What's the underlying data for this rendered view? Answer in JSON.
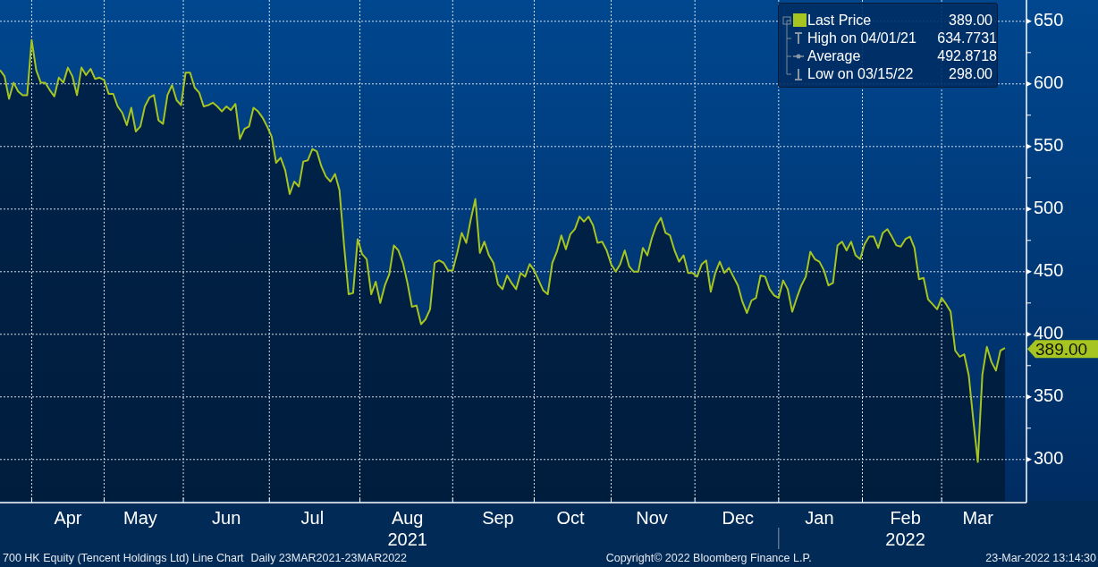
{
  "chart": {
    "chart_data": {
      "type": "area",
      "categories": [
        null,
        null,
        null,
        null,
        null,
        null,
        null,
        null,
        null,
        null,
        null,
        null,
        null,
        null,
        null,
        "Apr",
        null,
        null,
        null,
        null,
        null,
        null,
        null,
        null,
        null,
        null,
        null,
        null,
        null,
        null,
        null,
        "May",
        null,
        null,
        null,
        null,
        null,
        null,
        null,
        null,
        null,
        null,
        null,
        null,
        null,
        null,
        null,
        null,
        null,
        null,
        "Jun",
        null,
        null,
        null,
        null,
        null,
        null,
        null,
        null,
        null,
        null,
        null,
        null,
        null,
        null,
        null,
        null,
        null,
        null,
        "Jul",
        null,
        null,
        null,
        null,
        null,
        null,
        null,
        null,
        null,
        null,
        null,
        null,
        null,
        null,
        null,
        null,
        null,
        null,
        null,
        null,
        "Aug",
        null,
        null,
        null,
        null,
        null,
        null,
        null,
        null,
        null,
        null,
        null,
        null,
        null,
        null,
        null,
        null,
        null,
        null,
        null,
        "Sep",
        null,
        null,
        null,
        null,
        null,
        null,
        null,
        null,
        null,
        null,
        null,
        null,
        null,
        null,
        null,
        "Oct",
        null,
        null,
        null,
        null,
        null,
        null,
        null,
        null,
        null,
        null,
        null,
        null,
        null,
        null,
        null,
        null,
        null,
        "Nov",
        null,
        null,
        null,
        null,
        null,
        null,
        null,
        null,
        null,
        null,
        null,
        null,
        null,
        null,
        null,
        null,
        null,
        null,
        "Dec",
        null,
        null,
        null,
        null,
        null,
        null,
        null,
        null,
        null,
        null,
        null,
        null,
        null,
        null,
        null,
        null,
        null,
        "Jan",
        null,
        null,
        null,
        null,
        null,
        null,
        null,
        null,
        null,
        null,
        null,
        null,
        null,
        null,
        null,
        null,
        null,
        null,
        "Feb",
        null,
        null,
        null,
        null,
        null,
        null,
        null,
        null,
        null,
        null,
        null,
        null,
        null,
        null,
        null,
        "Mar",
        null,
        null,
        null,
        null,
        null,
        null
      ],
      "series": [
        {
          "color": "#a7c520",
          "values": [
            611,
            606,
            588,
            601,
            594,
            591,
            591,
            635,
            611,
            601,
            601,
            595,
            590,
            605,
            601,
            613,
            606,
            591,
            613,
            607,
            612,
            604,
            605,
            603,
            592,
            592,
            582,
            577,
            567,
            581,
            562,
            566,
            582,
            589,
            591,
            571,
            568,
            591,
            599,
            587,
            583,
            609,
            609,
            597,
            593,
            582,
            583,
            585,
            582,
            578,
            582,
            579,
            584,
            556,
            564,
            566,
            581,
            578,
            573,
            566,
            558,
            537,
            541,
            531,
            512,
            522,
            518,
            538,
            539,
            548,
            546,
            534,
            526,
            522,
            528,
            515,
            471,
            432,
            433,
            476,
            464,
            460,
            432,
            442,
            425,
            439,
            448,
            471,
            467,
            457,
            441,
            422,
            423,
            408,
            412,
            420,
            457,
            459,
            457,
            451,
            451,
            465,
            481,
            473,
            492,
            508,
            465,
            474,
            463,
            457,
            440,
            436,
            447,
            441,
            436,
            449,
            446,
            456,
            451,
            443,
            435,
            432,
            457,
            466,
            479,
            468,
            480,
            484,
            494,
            490,
            494,
            487,
            473,
            474,
            467,
            456,
            450,
            456,
            467,
            454,
            450,
            450,
            469,
            463,
            477,
            487,
            493,
            481,
            479,
            467,
            458,
            463,
            449,
            449,
            446,
            456,
            459,
            434,
            449,
            458,
            449,
            453,
            446,
            439,
            426,
            417,
            427,
            429,
            447,
            446,
            436,
            431,
            429,
            443,
            436,
            418,
            429,
            439,
            446,
            466,
            460,
            458,
            451,
            439,
            441,
            471,
            474,
            467,
            474,
            463,
            460,
            472,
            478,
            478,
            469,
            481,
            484,
            478,
            471,
            470,
            476,
            478,
            469,
            444,
            445,
            428,
            424,
            420,
            429,
            424,
            418,
            387,
            382,
            384,
            367,
            331,
            298,
            368,
            390,
            378,
            371,
            387,
            389
          ]
        }
      ],
      "grid": true,
      "ylim": [
        267,
        667
      ],
      "yticks": [
        300,
        350,
        400,
        450,
        500,
        550,
        600,
        650
      ]
    },
    "years": [
      {
        "label": "2021"
      },
      {
        "label": "2022"
      }
    ],
    "price_tag": "389.00"
  },
  "legend": [
    {
      "kind": "last",
      "label": "Last Price",
      "value": "389.00"
    },
    {
      "kind": "high",
      "label": "High on 04/01/21",
      "value": "634.7731"
    },
    {
      "kind": "average",
      "label": "Average",
      "value": "492.8718"
    },
    {
      "kind": "low",
      "label": "Low on 03/15/22",
      "value": "298.00"
    }
  ],
  "footer": {
    "title": "700 HK Equity (Tencent Holdings Ltd) Line Chart",
    "range": "Daily 23MAR2021-23MAR2022",
    "copyright": "Copyright© 2022 Bloomberg Finance L.P.",
    "timestamp": "23-Mar-2022 13:14:30"
  }
}
